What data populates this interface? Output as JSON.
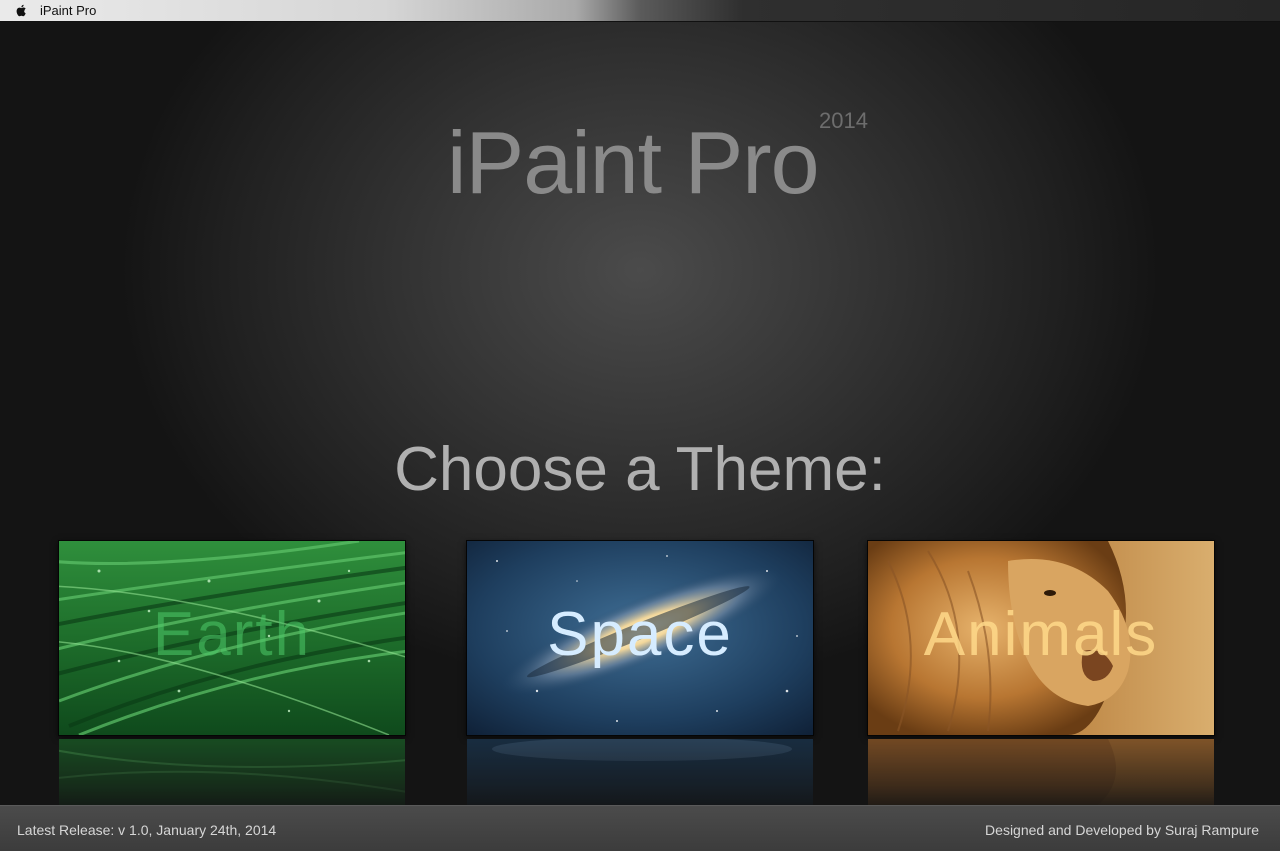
{
  "menubar": {
    "apple_icon": "apple-icon",
    "app_name": "iPaint Pro"
  },
  "header": {
    "title": "iPaint Pro",
    "year": "2014"
  },
  "main": {
    "heading": "Choose a Theme:",
    "themes": [
      {
        "label": "Earth",
        "image": "green-grass-with-dew",
        "label_color": "#4ecb6a"
      },
      {
        "label": "Space",
        "image": "galaxy-nebula",
        "label_color": "#cfe6ff"
      },
      {
        "label": "Animals",
        "image": "lion-portrait",
        "label_color": "#ffd98a"
      }
    ]
  },
  "footer": {
    "release": "Latest Release: v 1.0, January 24th, 2014",
    "credit": "Designed and Developed by Suraj Rampure"
  }
}
